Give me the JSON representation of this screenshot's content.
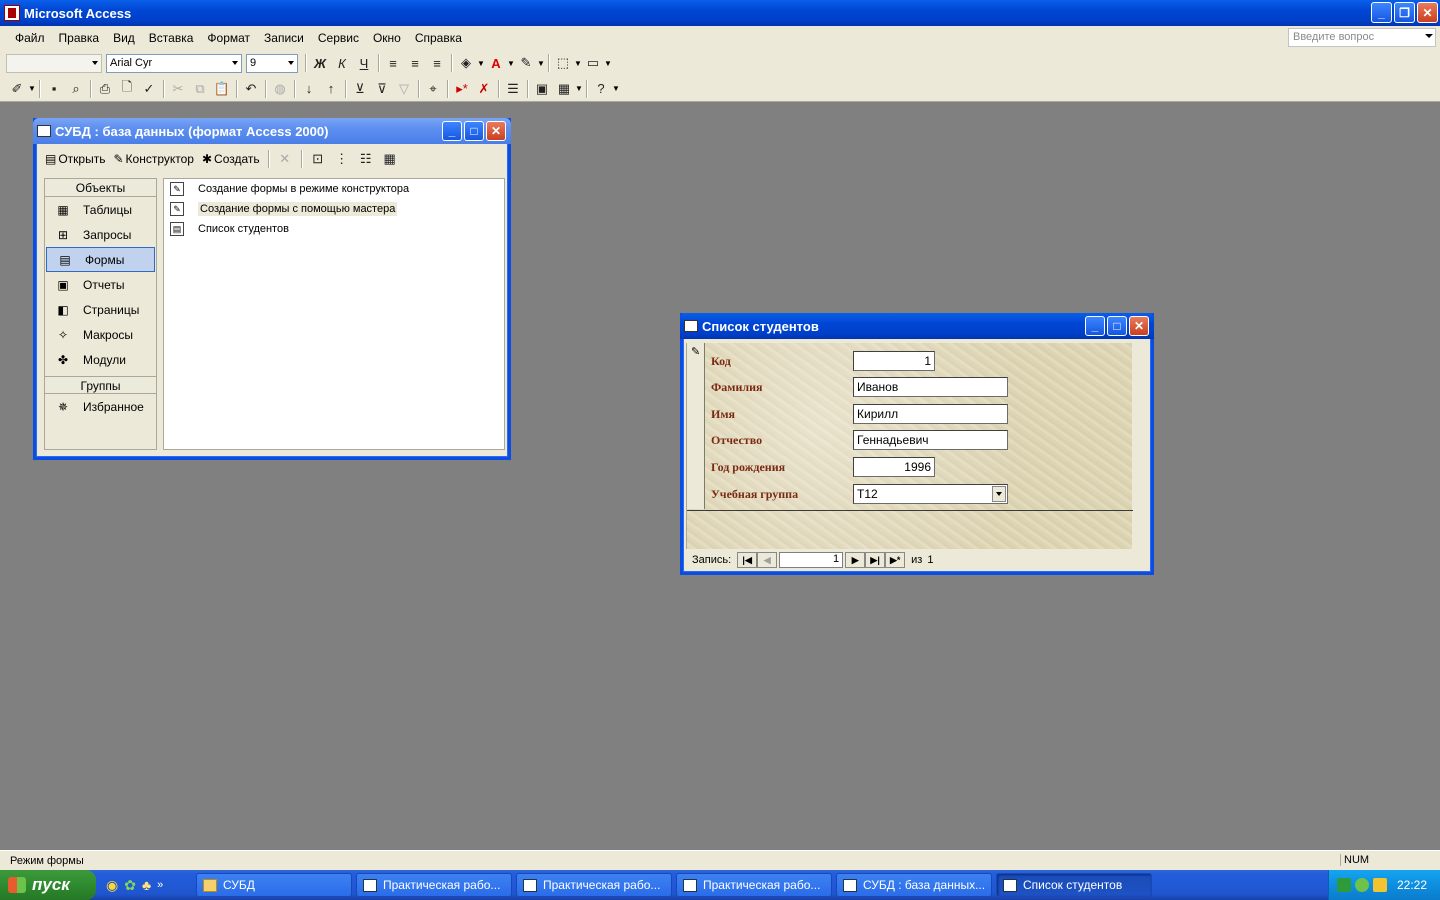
{
  "app": {
    "title": "Microsoft Access"
  },
  "menu": [
    "Файл",
    "Правка",
    "Вид",
    "Вставка",
    "Формат",
    "Записи",
    "Сервис",
    "Окно",
    "Справка"
  ],
  "ask_box": {
    "placeholder": "Введите вопрос"
  },
  "format_toolbar": {
    "object_combo": "",
    "font_name": "Arial Cyr",
    "font_size": "9",
    "bold": "Ж",
    "italic": "К",
    "underline": "Ч"
  },
  "db_window": {
    "title": "СУБД : база данных (формат Access 2000)",
    "actions": {
      "open": "Открыть",
      "design": "Конструктор",
      "create": "Создать"
    },
    "objects_header": "Объекты",
    "objects": [
      {
        "label": "Таблицы",
        "icon": "table-icon"
      },
      {
        "label": "Запросы",
        "icon": "query-icon"
      },
      {
        "label": "Формы",
        "icon": "form-icon",
        "selected": true
      },
      {
        "label": "Отчеты",
        "icon": "report-icon"
      },
      {
        "label": "Страницы",
        "icon": "page-icon"
      },
      {
        "label": "Макросы",
        "icon": "macro-icon"
      },
      {
        "label": "Модули",
        "icon": "module-icon"
      }
    ],
    "groups_header": "Группы",
    "groups": [
      {
        "label": "Избранное",
        "icon": "favorites-icon"
      }
    ],
    "items": [
      {
        "label": "Создание формы в режиме конструктора",
        "icon": "wizard-icon"
      },
      {
        "label": "Создание формы с помощью мастера",
        "icon": "wizard-icon"
      },
      {
        "label": "Список студентов",
        "icon": "form-icon"
      }
    ]
  },
  "form_window": {
    "title": "Список студентов",
    "fields": [
      {
        "label": "Код",
        "value": "1"
      },
      {
        "label": "Фамилия",
        "value": "Иванов"
      },
      {
        "label": "Имя",
        "value": "Кирилл"
      },
      {
        "label": "Отчество",
        "value": "Геннадьевич"
      },
      {
        "label": "Год рождения",
        "value": "1996"
      },
      {
        "label": "Учебная группа",
        "value": "Т12"
      }
    ],
    "nav": {
      "label": "Запись:",
      "current": "1",
      "of_label": "из",
      "total": "1"
    }
  },
  "status": {
    "mode": "Режим формы",
    "num": "NUM"
  },
  "taskbar": {
    "start": "пуск",
    "tasks": [
      {
        "label": "СУБД",
        "icon": "folder-icon"
      },
      {
        "label": "Практическая рабо...",
        "icon": "word-icon"
      },
      {
        "label": "Практическая рабо...",
        "icon": "word-icon"
      },
      {
        "label": "Практическая рабо...",
        "icon": "word-icon"
      },
      {
        "label": "СУБД : база данных...",
        "icon": "access-db-icon"
      },
      {
        "label": "Список студентов",
        "icon": "form-icon",
        "active": true
      }
    ],
    "clock": "22:22"
  }
}
